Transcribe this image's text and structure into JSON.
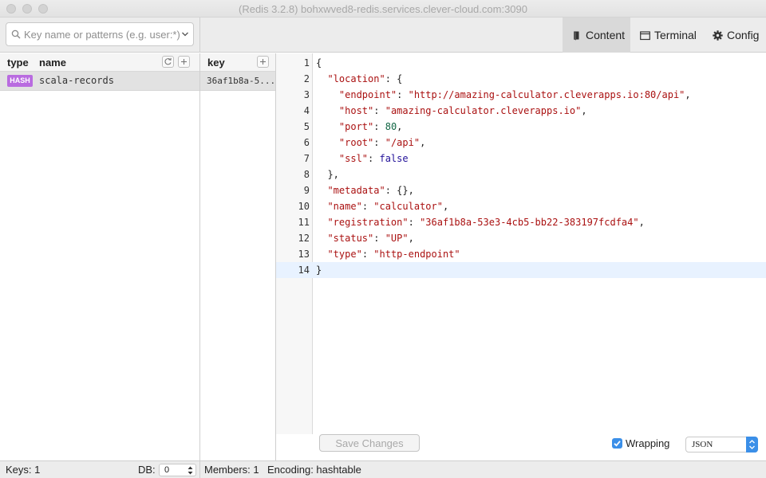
{
  "window": {
    "title": "(Redis 3.2.8) bohxwved8-redis.services.clever-cloud.com:3090"
  },
  "search": {
    "placeholder": "Key name or patterns (e.g. user:*)",
    "value": ""
  },
  "tabs": [
    {
      "label": "Content",
      "icon": "book-icon",
      "active": true
    },
    {
      "label": "Terminal",
      "icon": "terminal-icon",
      "active": false
    },
    {
      "label": "Config",
      "icon": "gear-icon",
      "active": false
    }
  ],
  "keys_panel": {
    "header_type": "type",
    "header_name": "name",
    "rows": [
      {
        "type": "HASH",
        "name": "scala-records"
      }
    ]
  },
  "members_panel": {
    "header_key": "key",
    "rows": [
      {
        "key": "36af1b8a-5..."
      }
    ]
  },
  "editor": {
    "lines": [
      "{",
      "  \"location\": {",
      "    \"endpoint\": \"http://amazing-calculator.cleverapps.io:80/api\",",
      "    \"host\": \"amazing-calculator.cleverapps.io\",",
      "    \"port\": 80,",
      "    \"root\": \"/api\",",
      "    \"ssl\": false",
      "  },",
      "  \"metadata\": {},",
      "  \"name\": \"calculator\",",
      "  \"registration\": \"36af1b8a-53e3-4cb5-bb22-383197fcdfa4\",",
      "  \"status\": \"UP\",",
      "  \"type\": \"http-endpoint\"",
      "}"
    ],
    "active_line": 14
  },
  "footer": {
    "save_label": "Save Changes",
    "wrapping_label": "Wrapping",
    "wrapping_checked": true,
    "format_value": "JSON"
  },
  "status": {
    "keys": "Keys: 1",
    "db_label": "DB:",
    "db_value": "0",
    "members": "Members: 1",
    "encoding": "Encoding: hashtable"
  },
  "colors": {
    "accent": "#3b8fe8",
    "hash_badge": "#b96be0",
    "string": "#aa1111",
    "number": "#116644",
    "boolean": "#221199"
  }
}
